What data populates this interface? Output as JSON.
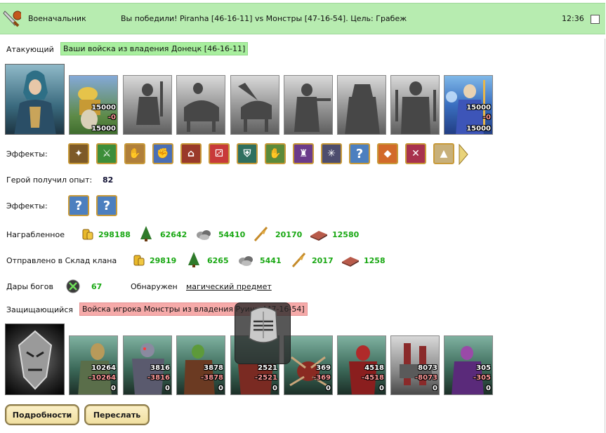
{
  "header": {
    "title": "Военачальник",
    "message": "Вы победили! Piranha [46-16-11] vs Монстры [47-16-54]. Цель: Грабеж",
    "time": "12:36"
  },
  "attacker": {
    "label": "Атакующий",
    "tag": "Ваши войска из владения Донецк [46-16-11]",
    "units": [
      {
        "name": "gold-caravan",
        "top": "15000",
        "mid": "-0",
        "bottom": "15000",
        "active": true
      },
      {
        "name": "swordsman",
        "top": "",
        "mid": "",
        "bottom": "",
        "active": false
      },
      {
        "name": "knight",
        "top": "",
        "mid": "",
        "bottom": "",
        "active": false
      },
      {
        "name": "pegasus",
        "top": "",
        "mid": "",
        "bottom": "",
        "active": false
      },
      {
        "name": "crossbowman",
        "top": "",
        "mid": "",
        "bottom": "",
        "active": false
      },
      {
        "name": "monk",
        "top": "",
        "mid": "",
        "bottom": "",
        "active": false
      },
      {
        "name": "warrior",
        "top": "",
        "mid": "",
        "bottom": "",
        "active": false
      },
      {
        "name": "mage",
        "top": "15000",
        "mid": "-0",
        "bottom": "15000",
        "active": true
      }
    ]
  },
  "effects1": {
    "label": "Эффекты:",
    "icons": [
      "pouch-icon",
      "sword-icon",
      "handshake-icon",
      "fist-icon",
      "temple-icon",
      "dice-icon",
      "shield-icon",
      "hand-shield-icon",
      "hood-icon",
      "web-icon",
      "question-icon",
      "gem-icon",
      "cross-out-icon",
      "pyramid-icon"
    ]
  },
  "experience": {
    "label": "Герой получил опыт:",
    "value": "82"
  },
  "effects2": {
    "label": "Эффекты:",
    "icons": [
      "question-icon",
      "question-icon"
    ]
  },
  "plundered": {
    "label": "Награбленное",
    "items": [
      {
        "icon": "gold-icon",
        "value": "298188"
      },
      {
        "icon": "wood-icon",
        "value": "62642"
      },
      {
        "icon": "ore-icon",
        "value": "54410"
      },
      {
        "icon": "grain-icon",
        "value": "20170"
      },
      {
        "icon": "brick-icon",
        "value": "12580"
      }
    ]
  },
  "clan": {
    "label": "Отправлено в Склад клана",
    "items": [
      {
        "icon": "gold-icon",
        "value": "29819"
      },
      {
        "icon": "wood-icon",
        "value": "6265"
      },
      {
        "icon": "ore-icon",
        "value": "5441"
      },
      {
        "icon": "grain-icon",
        "value": "2017"
      },
      {
        "icon": "brick-icon",
        "value": "1258"
      }
    ]
  },
  "gifts": {
    "label": "Дары богов",
    "value": "67",
    "found_label": "Обнаружен",
    "found_link": "магический предмет"
  },
  "defender": {
    "label": "Защищающийся",
    "tag": "Войска игрока Монстры из владения Руины [47-16-54]",
    "units": [
      {
        "name": "monster-1",
        "top": "10264",
        "mid": "-10264",
        "bottom": "0"
      },
      {
        "name": "monster-2",
        "top": "3816",
        "mid": "-3816",
        "bottom": "0"
      },
      {
        "name": "monster-3",
        "top": "3878",
        "mid": "-3878",
        "bottom": "0"
      },
      {
        "name": "monster-4",
        "top": "2521",
        "mid": "-2521",
        "bottom": "0"
      },
      {
        "name": "monster-5",
        "top": "369",
        "mid": "-369",
        "bottom": "0"
      },
      {
        "name": "monster-6",
        "top": "4518",
        "mid": "-4518",
        "bottom": "0"
      },
      {
        "name": "monster-7",
        "top": "8073",
        "mid": "-8073",
        "bottom": "0"
      },
      {
        "name": "monster-8",
        "top": "305",
        "mid": "-305",
        "bottom": "0"
      }
    ]
  },
  "buttons": {
    "details": "Подробности",
    "forward": "Переслать"
  },
  "colors": {
    "header_bg": "#b7ecb0",
    "attacker_tag": "#a8ef9e",
    "defender_tag": "#f6aaa9",
    "value_green": "#1aa814"
  }
}
